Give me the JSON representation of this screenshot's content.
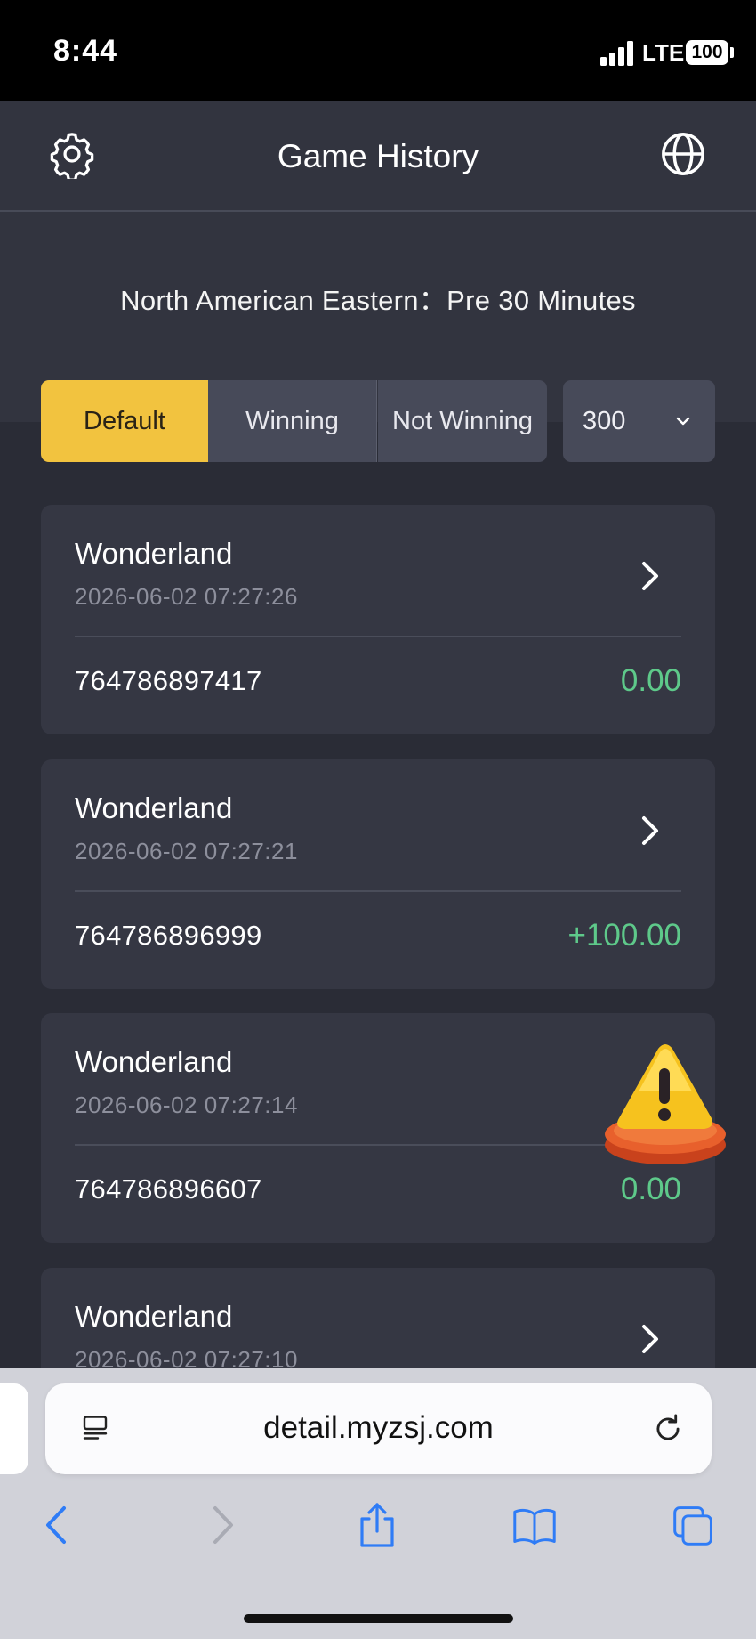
{
  "status_bar": {
    "time": "8:44",
    "network": "LTE",
    "battery": "100"
  },
  "header": {
    "title": "Game History",
    "settings_icon": "gear-icon",
    "language_icon": "globe-icon"
  },
  "timezone_text": "North American Eastern：Pre 30 Minutes",
  "filters": {
    "tabs": [
      {
        "label": "Default",
        "active": true
      },
      {
        "label": "Winning",
        "active": false
      },
      {
        "label": "Not Winning",
        "active": false
      }
    ],
    "count_select": {
      "value": "300"
    }
  },
  "records": [
    {
      "game": "Wonderland",
      "time": "2026-06-02 07:27:26",
      "order_id": "764786897417",
      "amount": "0.00"
    },
    {
      "game": "Wonderland",
      "time": "2026-06-02 07:27:21",
      "order_id": "764786896999",
      "amount": "+100.00"
    },
    {
      "game": "Wonderland",
      "time": "2026-06-02 07:27:14",
      "order_id": "764786896607",
      "amount": "0.00"
    },
    {
      "game": "Wonderland",
      "time": "2026-06-02 07:27:10",
      "order_id": "",
      "amount": ""
    }
  ],
  "browser": {
    "url": "detail.myzsj.com"
  },
  "colors": {
    "accent": "#f2c33f",
    "positive": "#5ec98a",
    "background": "#2a2c36"
  }
}
